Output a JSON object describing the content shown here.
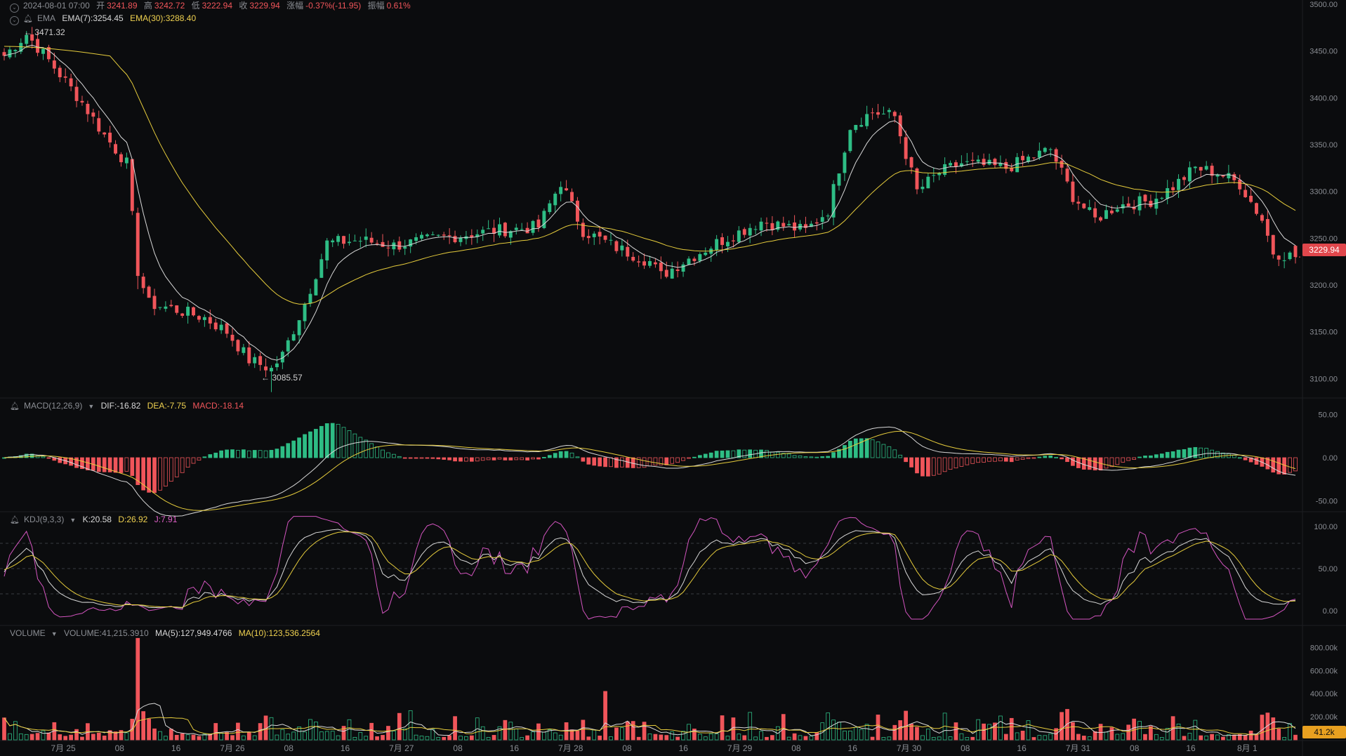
{
  "header": {
    "date": "2024-08-01 07:00",
    "open_label": "开",
    "open": "3241.89",
    "high_label": "高",
    "high": "3242.72",
    "low_label": "低",
    "low": "3222.94",
    "close_label": "收",
    "close": "3229.94",
    "change_label": "涨幅",
    "change": "-0.37%(-11.95)",
    "amplitude_label": "振幅",
    "amplitude": "0.61%"
  },
  "ema_legend": {
    "name": "EMA",
    "ema7": "EMA(7):3254.45",
    "ema30": "EMA(30):3288.40"
  },
  "macd_legend": {
    "name": "MACD(12,26,9)",
    "dif": "DIF:-16.82",
    "dea": "DEA:-7.75",
    "macd": "MACD:-18.14"
  },
  "kdj_legend": {
    "name": "KDJ(9,3,3)",
    "k": "K:20.58",
    "d": "D:26.92",
    "j": "J:7.91"
  },
  "vol_legend": {
    "name": "VOLUME",
    "vol": "VOLUME:41,215.3910",
    "ma5": "MA(5):127,949.4766",
    "ma10": "MA(10):123,536.2564"
  },
  "annotations": {
    "high_mark": "3471.32",
    "low_mark": "3085.57"
  },
  "price_tag": "3229.94",
  "volume_tag": "41.2k",
  "colors": {
    "up": "#2ebd85",
    "down": "#f0555a",
    "ema7": "#d8d8d8",
    "ema30": "#e6cc3c",
    "j": "#d455c0",
    "bg": "#0b0c0e"
  },
  "chart_data": {
    "type": "candlestick",
    "interval": "1h",
    "x_labels": [
      "7月 25",
      "08",
      "16",
      "7月 26",
      "08",
      "16",
      "7月 27",
      "08",
      "16",
      "7月 28",
      "08",
      "16",
      "7月 29",
      "08",
      "16",
      "7月 30",
      "08",
      "16",
      "7月 31",
      "08",
      "16",
      "8月 1"
    ],
    "price_axis": {
      "ticks": [
        "3500.00",
        "3450.00",
        "3400.00",
        "3350.00",
        "3300.00",
        "3250.00",
        "3200.00",
        "3150.00",
        "3100.00"
      ],
      "ylim": [
        3080,
        3500
      ]
    },
    "macd_axis": {
      "ticks": [
        "50.00",
        "0.00",
        "-50.00"
      ]
    },
    "kdj_axis": {
      "ticks": [
        "100.00",
        "50.00",
        "0.00"
      ]
    },
    "volume_axis": {
      "ticks": [
        "800.00k",
        "600.00k",
        "400.00k",
        "200.00k"
      ]
    },
    "close_anchors": [
      [
        0,
        3445
      ],
      [
        4,
        3468
      ],
      [
        8,
        3440
      ],
      [
        14,
        3395
      ],
      [
        18,
        3360
      ],
      [
        22,
        3330
      ],
      [
        24,
        3215
      ],
      [
        26,
        3180
      ],
      [
        30,
        3175
      ],
      [
        36,
        3165
      ],
      [
        40,
        3150
      ],
      [
        44,
        3120
      ],
      [
        48,
        3110
      ],
      [
        50,
        3125
      ],
      [
        54,
        3180
      ],
      [
        58,
        3245
      ],
      [
        64,
        3248
      ],
      [
        70,
        3242
      ],
      [
        78,
        3250
      ],
      [
        88,
        3258
      ],
      [
        96,
        3262
      ],
      [
        100,
        3310
      ],
      [
        104,
        3258
      ],
      [
        110,
        3240
      ],
      [
        116,
        3225
      ],
      [
        118,
        3210
      ],
      [
        122,
        3225
      ],
      [
        128,
        3245
      ],
      [
        136,
        3268
      ],
      [
        144,
        3258
      ],
      [
        148,
        3280
      ],
      [
        152,
        3370
      ],
      [
        156,
        3385
      ],
      [
        160,
        3380
      ],
      [
        164,
        3300
      ],
      [
        168,
        3320
      ],
      [
        172,
        3330
      ],
      [
        180,
        3325
      ],
      [
        184,
        3335
      ],
      [
        188,
        3345
      ],
      [
        190,
        3320
      ],
      [
        192,
        3295
      ],
      [
        196,
        3270
      ],
      [
        200,
        3285
      ],
      [
        206,
        3290
      ],
      [
        210,
        3305
      ],
      [
        214,
        3325
      ],
      [
        218,
        3320
      ],
      [
        222,
        3308
      ],
      [
        226,
        3270
      ],
      [
        228,
        3235
      ],
      [
        232,
        3230
      ]
    ],
    "high_value": 3471.32,
    "low_value": 3085.57,
    "ema7_last": 3254.45,
    "ema30_last": 3288.4,
    "last_close": 3229.94
  }
}
